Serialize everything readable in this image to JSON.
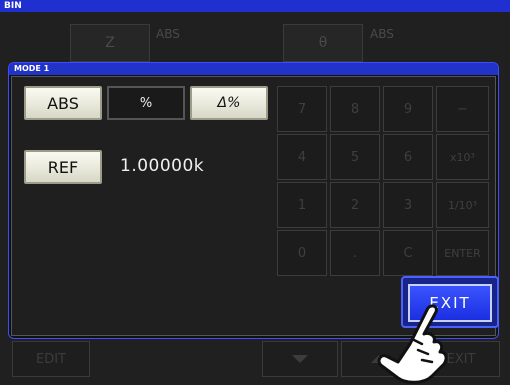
{
  "app": {
    "title": "BIN"
  },
  "background": {
    "param1_label": "Z",
    "param1_mode": "ABS",
    "param2_label": "θ",
    "param2_mode": "ABS",
    "edit_label": "EDIT",
    "exit_label": "EXIT"
  },
  "dialog": {
    "title": "MODE 1",
    "modes": [
      "ABS",
      "%",
      "Δ%"
    ],
    "selected_mode": "%",
    "ref_label": "REF",
    "ref_value": "1.00000k",
    "exit_label": "EXIT"
  },
  "keypad": {
    "keys": [
      "7",
      "8",
      "9",
      "−",
      "4",
      "5",
      "6",
      "x10³",
      "1",
      "2",
      "3",
      "1/10³",
      "0",
      ".",
      "C",
      "ENTER"
    ],
    "enabled": false
  },
  "colors": {
    "title_bar": "#1f2fd0",
    "accent": "#2233c8",
    "exit_button": "#2a44ff"
  }
}
